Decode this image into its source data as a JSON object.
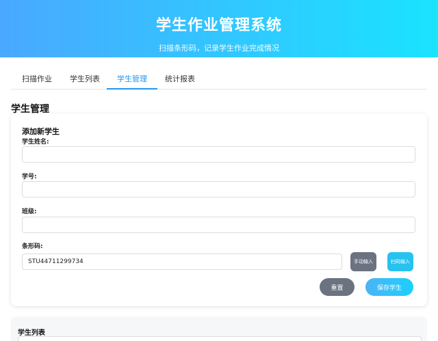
{
  "header": {
    "title": "学生作业管理系统",
    "subtitle": "扫描条形码，记录学生作业完成情况"
  },
  "tabs": [
    {
      "label": "扫描作业"
    },
    {
      "label": "学生列表"
    },
    {
      "label": "学生管理",
      "active": true
    },
    {
      "label": "统计报表"
    }
  ],
  "section": {
    "title": "学生管理"
  },
  "add_form": {
    "title": "添加新学生",
    "name_label": "学生姓名:",
    "name_value": "",
    "id_label": "学号:",
    "id_value": "",
    "class_label": "班级:",
    "class_value": "",
    "barcode_label": "条形码:",
    "barcode_value": "STU44711299734",
    "manual_button": "手动输入",
    "scan_button": "扫码输入",
    "reset_button": "重置",
    "save_button": "保存学生"
  },
  "student_list": {
    "title": "学生列表"
  },
  "colors": {
    "header_start": "#4aa8ff",
    "header_end": "#1ae3ff",
    "active_tab": "#2196f3",
    "gray_button": "#6b7280",
    "accent_button": "#27c2ef"
  }
}
